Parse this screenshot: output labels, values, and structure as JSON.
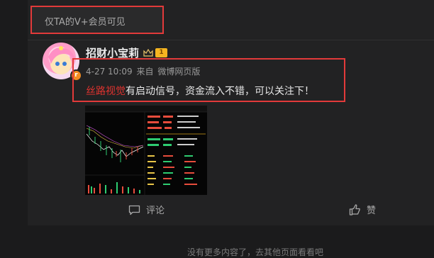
{
  "notice": {
    "vip_only": "仅TA的V+会员可见"
  },
  "post": {
    "username": "招财小宝莉",
    "level_badge": "1",
    "avatar_badge": "r",
    "time": "4-27 10:09",
    "source_prefix": "来自",
    "source": "微博网页版",
    "topic": "丝路视觉",
    "text": "有启动信号，资金流入不错，可以关注下！"
  },
  "actions": {
    "comment": "评论",
    "like": "赞"
  },
  "footer": {
    "text": "没有更多内容了，去其他页面看看吧"
  },
  "colors": {
    "highlight_border": "#e23a3a",
    "topic_red": "#e0332f",
    "background": "#1b1b1c"
  },
  "icons": {
    "comment": "comment-icon",
    "like": "thumbs-up-icon",
    "crown": "crown-icon"
  }
}
